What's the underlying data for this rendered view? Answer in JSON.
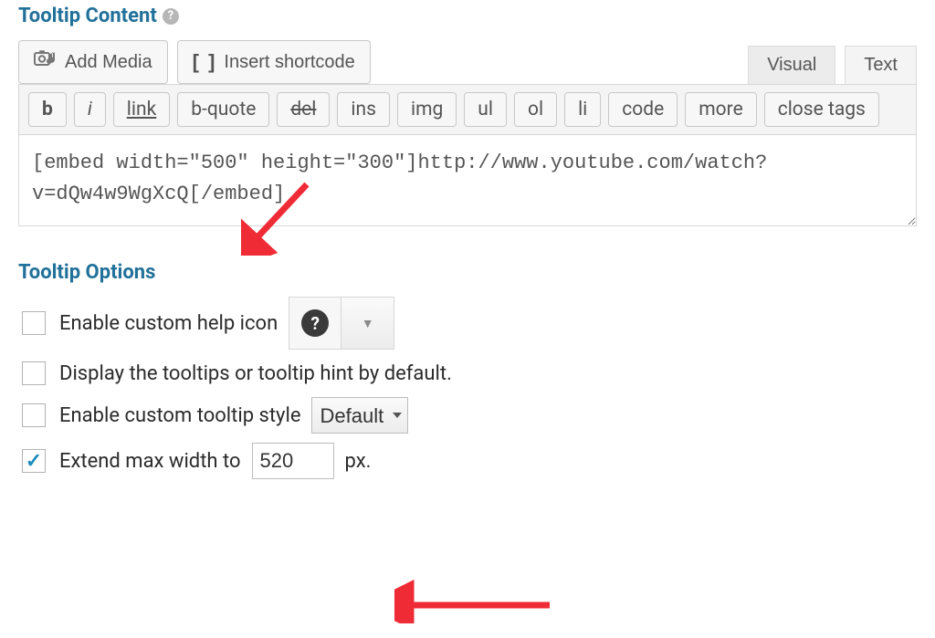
{
  "heading_content": "Tooltip Content",
  "heading_options": "Tooltip Options",
  "topbar": {
    "add_media": "Add Media",
    "insert_sc": "Insert shortcode",
    "tab_visual": "Visual",
    "tab_text": "Text"
  },
  "quicktags": {
    "b": "b",
    "i": "i",
    "link": "link",
    "bquote": "b-quote",
    "del": "del",
    "ins": "ins",
    "img": "img",
    "ul": "ul",
    "ol": "ol",
    "li": "li",
    "code": "code",
    "more": "more",
    "close": "close tags"
  },
  "editor_value": "[embed width=\"500\" height=\"300\"]http://www.youtube.com/watch?v=dQw4w9WgXcQ[/embed]",
  "opts": {
    "enable_icon": "Enable custom help icon",
    "display_default": "Display the tooltips or tooltip hint by default.",
    "enable_style": "Enable custom tooltip style",
    "style_selected": "Default",
    "extend_left": "Extend max width to",
    "extend_right": "px.",
    "extend_value": "520"
  }
}
